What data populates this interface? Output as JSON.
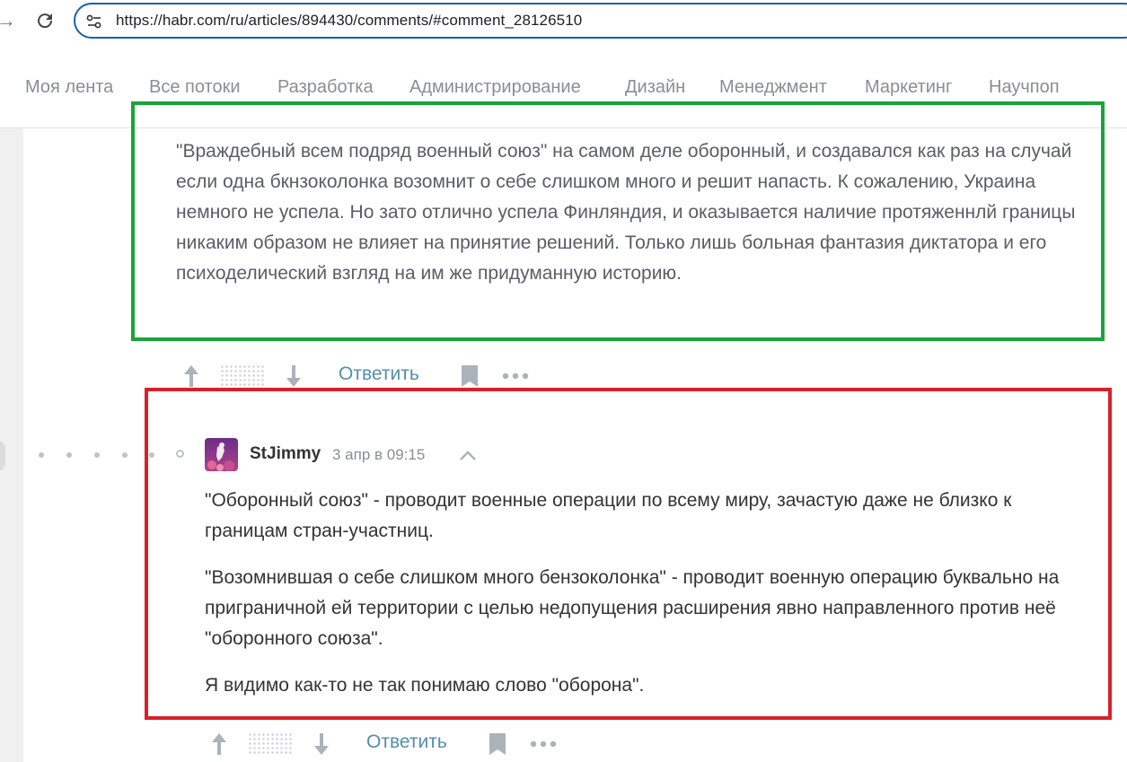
{
  "browser": {
    "url": "https://habr.com/ru/articles/894430/comments/#comment_28126510"
  },
  "nav": {
    "items": [
      "Моя лента",
      "Все потоки",
      "Разработка",
      "Администрирование",
      "Дизайн",
      "Менеджмент",
      "Маркетинг",
      "Научпоп"
    ]
  },
  "parent_comment": {
    "text": "\"Враждебный всем подряд военный союз\" на самом деле оборонный, и создавался как раз на случай если одна бкнзоколонка возомнит о себе слишком много и решит напасть. К сожалению, Украина немного не успела. Но зато отлично успела Финляндия, и оказывается наличие протяженнлй границы никаким образом не влияет на принятие решений. Только лишь больная фантазия диктатора и его психоделический взгляд на им же придуманную историю.",
    "reply_label": "Ответить"
  },
  "reply_comment": {
    "username": "StJimmy",
    "timestamp": "3 апр в 09:15",
    "paragraphs": [
      "\"Оборонный союз\" - проводит военные операции по всему миру, зачастую даже не близко к границам стран-участниц.",
      "\"Возомнившая о себе слишком много бензоколонка\" - проводит военную операцию буквально на приграничной ей территории с целью недопущения расширения явно направленного против неё \"оборонного союза\".",
      "Я видимо как-то не так понимаю слово \"оборона\"."
    ],
    "reply_label": "Ответить"
  },
  "icons": {
    "vote_up": "arrow-up-icon",
    "vote_down": "arrow-down-icon",
    "bookmark": "bookmark-icon",
    "more": "more-dots-icon",
    "collapse": "chevron-up-icon",
    "reload": "reload-icon",
    "site_settings": "site-settings-icon"
  },
  "colors": {
    "highlight_green": "#1aa33a",
    "highlight_red": "#d9202a",
    "link": "#548eaa",
    "url_border": "#1a5fb4"
  }
}
